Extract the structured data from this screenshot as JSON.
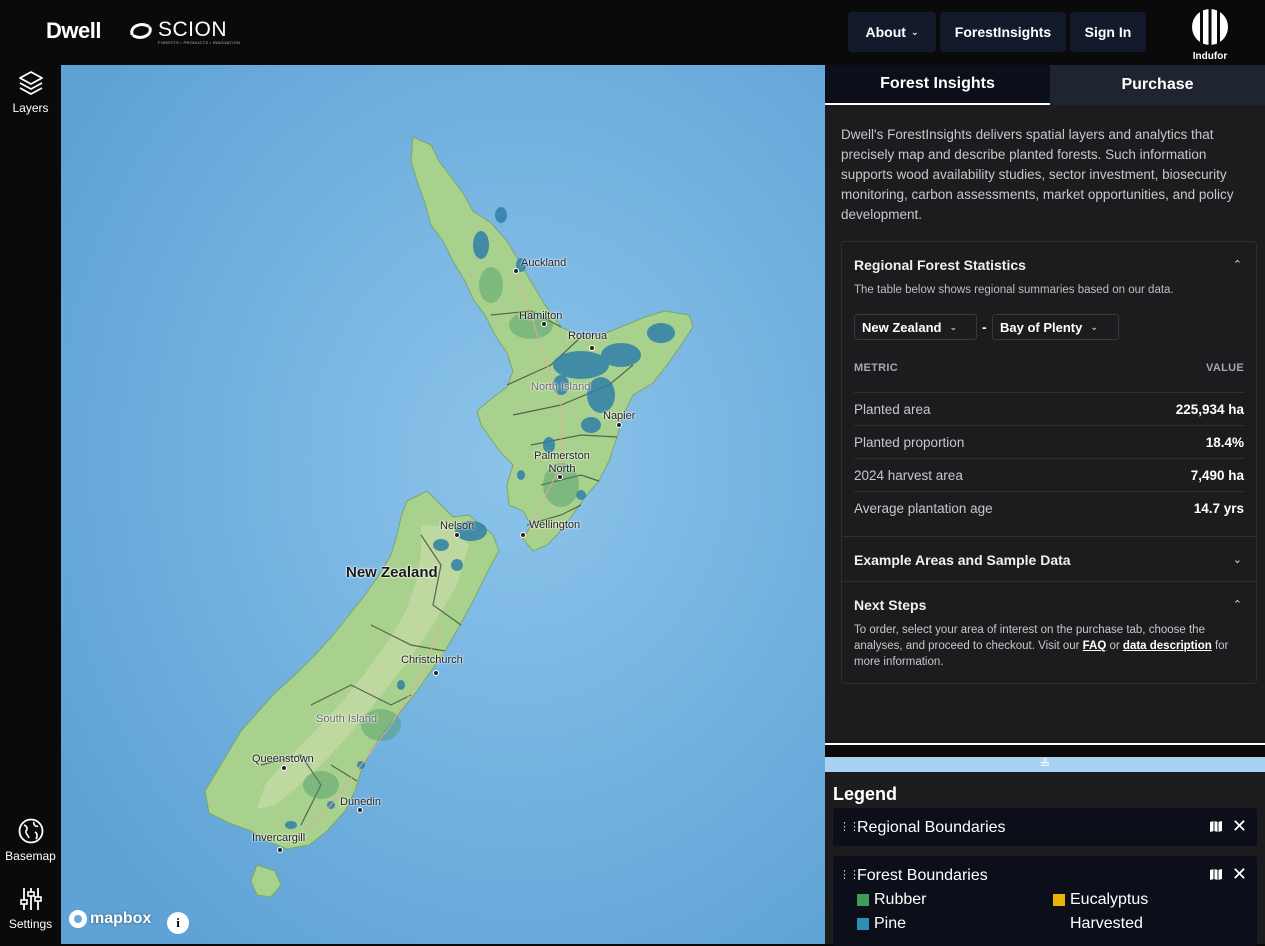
{
  "header": {
    "brand": "Dwell",
    "partner_logo": "SCION",
    "partner_tagline": "FORESTS • PRODUCTS • INNOVATION",
    "nav": {
      "about": "About",
      "forest_insights": "ForestInsights",
      "sign_in": "Sign In"
    },
    "indufor_label": "Indufor"
  },
  "sidebar": {
    "layers": "Layers",
    "basemap": "Basemap",
    "settings": "Settings"
  },
  "map": {
    "labels": {
      "country": "New Zealand",
      "north_island": "North Island",
      "south_island": "South Island",
      "auckland": "Auckland",
      "hamilton": "Hamilton",
      "rotorua": "Rotorua",
      "napier": "Napier",
      "palmerston_north": "Palmerston North",
      "wellington": "Wellington",
      "nelson": "Nelson",
      "christchurch": "Christchurch",
      "queenstown": "Queenstown",
      "dunedin": "Dunedin",
      "invercargill": "Invercargill"
    },
    "attribution": "mapbox",
    "info_symbol": "i"
  },
  "panel": {
    "tabs": [
      "Forest Insights",
      "Purchase"
    ],
    "active_tab": "Forest Insights",
    "intro": "Dwell's ForestInsights delivers spatial layers and analytics that precisely map and describe planted forests. Such information supports wood availability studies, sector investment, biosecurity monitoring, carbon assessments, market opportunities, and policy development.",
    "regional": {
      "title": "Regional Forest Statistics",
      "subtitle": "The table below shows regional summaries based on our data.",
      "country": "New Zealand",
      "separator": "-",
      "region": "Bay of Plenty",
      "headers": {
        "metric": "METRIC",
        "value": "VALUE"
      },
      "rows": [
        {
          "metric": "Planted area",
          "value": "225,934 ha"
        },
        {
          "metric": "Planted proportion",
          "value": "18.4%"
        },
        {
          "metric": "2024 harvest area",
          "value": "7,490 ha"
        },
        {
          "metric": "Average plantation age",
          "value": "14.7 yrs"
        }
      ]
    },
    "example_section": "Example Areas and Sample Data",
    "next_steps": {
      "title": "Next Steps",
      "text_before": "To order, select your area of interest on the purchase tab, choose the analyses, and proceed to checkout. Visit our ",
      "faq_link": "FAQ",
      "text_middle": " or ",
      "desc_link": "data description",
      "text_after": " for more information."
    }
  },
  "legend": {
    "title": "Legend",
    "layers": [
      {
        "name": "Regional Boundaries"
      },
      {
        "name": "Forest Boundaries"
      }
    ],
    "forest_classes": [
      {
        "label": "Rubber",
        "color": "#3f9c5b"
      },
      {
        "label": "Eucalyptus",
        "color": "#e8b400"
      },
      {
        "label": "Pine",
        "color": "#2d8fb5"
      },
      {
        "label": "Harvested",
        "color": ""
      }
    ]
  },
  "colors": {
    "background": "#0a0a0b",
    "panel": "#1c1c1f",
    "ocean": "#6aaad9",
    "land": "#a9d18e",
    "forest": "#2f7fa8"
  }
}
